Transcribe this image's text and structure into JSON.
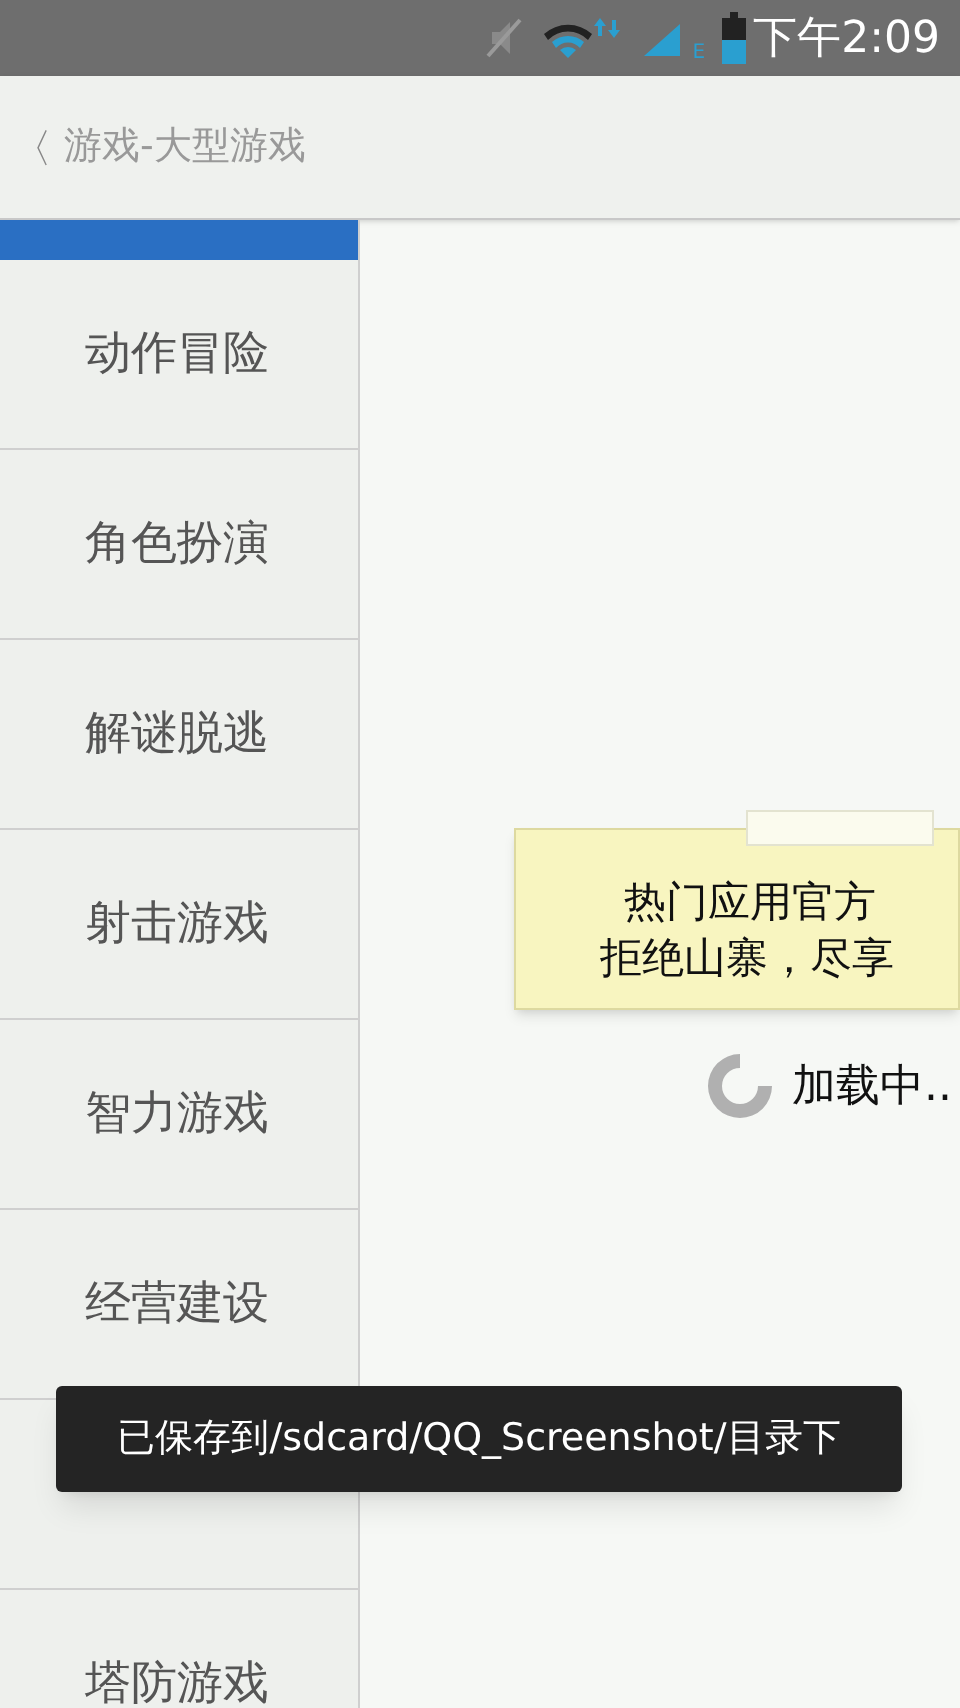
{
  "status_bar": {
    "time": "下午2:09",
    "network_type": "E"
  },
  "header": {
    "back_icon": "〈",
    "title": "游戏-大型游戏"
  },
  "sidebar": {
    "items": [
      {
        "kind": "text",
        "label": "动作冒险"
      },
      {
        "kind": "text",
        "label": "角色扮演"
      },
      {
        "kind": "text",
        "label": "解谜脱逃"
      },
      {
        "kind": "text",
        "label": "射击游戏"
      },
      {
        "kind": "text",
        "label": "智力游戏"
      },
      {
        "kind": "text",
        "label": "经营建设"
      },
      {
        "kind": "covered"
      },
      {
        "kind": "text",
        "label": "塔防游戏"
      }
    ]
  },
  "notice": {
    "lines": [
      "热门应用官方",
      "拒绝山寨，尽享"
    ]
  },
  "loading": {
    "text": "加载中.."
  },
  "toast": {
    "text": "已保存到/sdcard/QQ_Screenshot/目录下"
  }
}
